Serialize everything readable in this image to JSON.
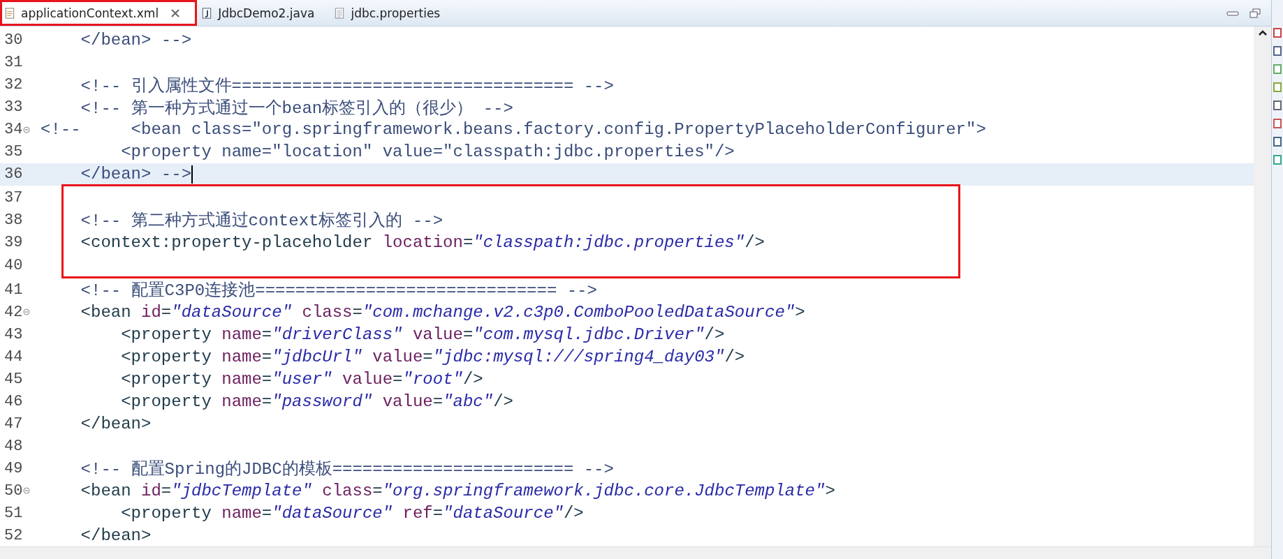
{
  "tabs": [
    {
      "label": "applicationContext.xml",
      "selected": true,
      "closable": true,
      "marked": true
    },
    {
      "label": "JdbcDemo2.java",
      "selected": false,
      "closable": false,
      "marked": false
    },
    {
      "label": "jdbc.properties",
      "selected": false,
      "closable": false,
      "marked": false
    }
  ],
  "editor": {
    "lines": [
      {
        "number": "30",
        "fold": false,
        "current": false,
        "boxed": false,
        "tokens": [
          {
            "kind": "comment",
            "text": "    </bean> -->"
          }
        ]
      },
      {
        "number": "31",
        "fold": false,
        "current": false,
        "boxed": false
      },
      {
        "number": "32",
        "fold": false,
        "current": false,
        "boxed": false,
        "tokens": [
          {
            "kind": "comment",
            "text": "    <!-- 引入属性文件================================== -->"
          }
        ]
      },
      {
        "number": "33",
        "fold": false,
        "current": false,
        "boxed": false,
        "tokens": [
          {
            "kind": "comment",
            "text": "    <!-- 第一种方式通过一个bean标签引入的（很少） -->"
          }
        ]
      },
      {
        "number": "34",
        "fold": true,
        "current": false,
        "boxed": false,
        "tokens": [
          {
            "kind": "comment",
            "text": "<!--     <bean class=\"org.springframework.beans.factory.config.PropertyPlaceholderConfigurer\">"
          }
        ]
      },
      {
        "number": "35",
        "fold": false,
        "current": false,
        "boxed": false,
        "tokens": [
          {
            "kind": "comment",
            "text": "        <property name=\"location\" value=\"classpath:jdbc.properties\"/>"
          }
        ]
      },
      {
        "number": "36",
        "fold": false,
        "current": true,
        "boxed": false,
        "tokens": [
          {
            "kind": "comment",
            "text": "    </bean> -->"
          }
        ]
      },
      {
        "number": "37",
        "fold": false,
        "current": false,
        "boxed": true
      },
      {
        "number": "38",
        "fold": false,
        "current": false,
        "boxed": true,
        "tokens": [
          {
            "kind": "comment",
            "text": "    <!-- 第二种方式通过context标签引入的 -->"
          }
        ]
      },
      {
        "number": "39",
        "fold": false,
        "current": false,
        "boxed": true,
        "tokens": [
          {
            "kind": "tag",
            "text": "    <context:property-placeholder "
          },
          {
            "kind": "attr",
            "text": "location"
          },
          {
            "kind": "tag",
            "text": "="
          },
          {
            "kind": "value",
            "text": "\"classpath:jdbc.properties\""
          },
          {
            "kind": "tag",
            "text": "/>"
          }
        ]
      },
      {
        "number": "40",
        "fold": false,
        "current": false,
        "boxed": true
      },
      {
        "number": "41",
        "fold": false,
        "current": false,
        "boxed": false,
        "tokens": [
          {
            "kind": "comment",
            "text": "    <!-- 配置C3P0连接池============================== -->"
          }
        ]
      },
      {
        "number": "42",
        "fold": true,
        "current": false,
        "boxed": false,
        "tokens": [
          {
            "kind": "tag",
            "text": "    <bean "
          },
          {
            "kind": "attr",
            "text": "id"
          },
          {
            "kind": "tag",
            "text": "="
          },
          {
            "kind": "value",
            "text": "\"dataSource\""
          },
          {
            "kind": "attr",
            "text": " class"
          },
          {
            "kind": "tag",
            "text": "="
          },
          {
            "kind": "value",
            "text": "\"com.mchange.v2.c3p0.ComboPooledDataSource\""
          },
          {
            "kind": "tag",
            "text": ">"
          }
        ]
      },
      {
        "number": "43",
        "fold": false,
        "current": false,
        "boxed": false,
        "tokens": [
          {
            "kind": "tag",
            "text": "        <property "
          },
          {
            "kind": "attr",
            "text": "name"
          },
          {
            "kind": "tag",
            "text": "="
          },
          {
            "kind": "value",
            "text": "\"driverClass\""
          },
          {
            "kind": "attr",
            "text": " value"
          },
          {
            "kind": "tag",
            "text": "="
          },
          {
            "kind": "value",
            "text": "\"com.mysql.jdbc.Driver\""
          },
          {
            "kind": "tag",
            "text": "/>"
          }
        ]
      },
      {
        "number": "44",
        "fold": false,
        "current": false,
        "boxed": false,
        "tokens": [
          {
            "kind": "tag",
            "text": "        <property "
          },
          {
            "kind": "attr",
            "text": "name"
          },
          {
            "kind": "tag",
            "text": "="
          },
          {
            "kind": "value",
            "text": "\"jdbcUrl\""
          },
          {
            "kind": "attr",
            "text": " value"
          },
          {
            "kind": "tag",
            "text": "="
          },
          {
            "kind": "value",
            "text": "\"jdbc:mysql:///spring4_day03\""
          },
          {
            "kind": "tag",
            "text": "/>"
          }
        ]
      },
      {
        "number": "45",
        "fold": false,
        "current": false,
        "boxed": false,
        "tokens": [
          {
            "kind": "tag",
            "text": "        <property "
          },
          {
            "kind": "attr",
            "text": "name"
          },
          {
            "kind": "tag",
            "text": "="
          },
          {
            "kind": "value",
            "text": "\"user\""
          },
          {
            "kind": "attr",
            "text": " value"
          },
          {
            "kind": "tag",
            "text": "="
          },
          {
            "kind": "value",
            "text": "\"root\""
          },
          {
            "kind": "tag",
            "text": "/>"
          }
        ]
      },
      {
        "number": "46",
        "fold": false,
        "current": false,
        "boxed": false,
        "tokens": [
          {
            "kind": "tag",
            "text": "        <property "
          },
          {
            "kind": "attr",
            "text": "name"
          },
          {
            "kind": "tag",
            "text": "="
          },
          {
            "kind": "value",
            "text": "\"password\""
          },
          {
            "kind": "attr",
            "text": " value"
          },
          {
            "kind": "tag",
            "text": "="
          },
          {
            "kind": "value",
            "text": "\"abc\""
          },
          {
            "kind": "tag",
            "text": "/>"
          }
        ]
      },
      {
        "number": "47",
        "fold": false,
        "current": false,
        "boxed": false,
        "tokens": [
          {
            "kind": "tag",
            "text": "    </bean>"
          }
        ]
      },
      {
        "number": "48",
        "fold": false,
        "current": false,
        "boxed": false
      },
      {
        "number": "49",
        "fold": false,
        "current": false,
        "boxed": false,
        "tokens": [
          {
            "kind": "comment",
            "text": "    <!-- 配置Spring的JDBC的模板======================== -->"
          }
        ]
      },
      {
        "number": "50",
        "fold": true,
        "current": false,
        "boxed": false,
        "tokens": [
          {
            "kind": "tag",
            "text": "    <bean "
          },
          {
            "kind": "attr",
            "text": "id"
          },
          {
            "kind": "tag",
            "text": "="
          },
          {
            "kind": "value",
            "text": "\"jdbcTemplate\""
          },
          {
            "kind": "attr",
            "text": " class"
          },
          {
            "kind": "tag",
            "text": "="
          },
          {
            "kind": "value",
            "text": "\"org.springframework.jdbc.core.JdbcTemplate\""
          },
          {
            "kind": "tag",
            "text": ">"
          }
        ]
      },
      {
        "number": "51",
        "fold": false,
        "current": false,
        "boxed": false,
        "tokens": [
          {
            "kind": "tag",
            "text": "        <property "
          },
          {
            "kind": "attr",
            "text": "name"
          },
          {
            "kind": "tag",
            "text": "="
          },
          {
            "kind": "value",
            "text": "\"dataSource\""
          },
          {
            "kind": "attr",
            "text": " ref"
          },
          {
            "kind": "tag",
            "text": "="
          },
          {
            "kind": "value",
            "text": "\"dataSource\""
          },
          {
            "kind": "tag",
            "text": "/>"
          }
        ]
      },
      {
        "number": "52",
        "fold": false,
        "current": false,
        "boxed": false,
        "tokens": [
          {
            "kind": "tag",
            "text": "    </bean>"
          }
        ]
      }
    ]
  }
}
